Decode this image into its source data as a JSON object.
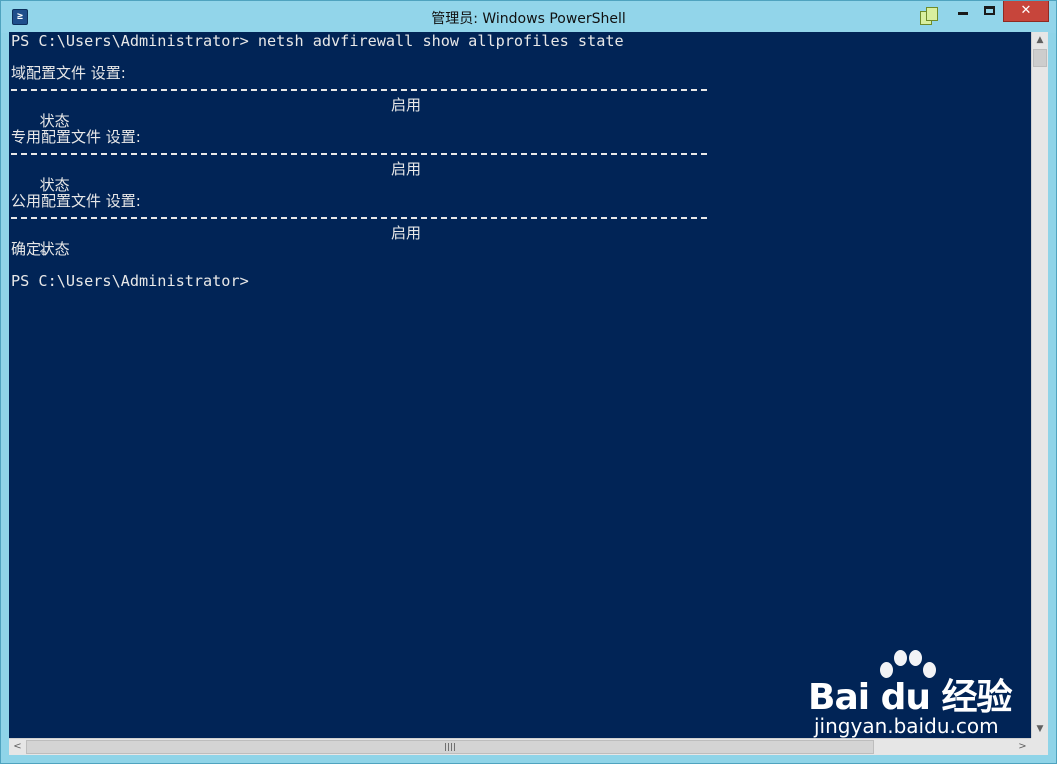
{
  "window": {
    "title": "管理员: Windows PowerShell",
    "close_glyph": "✕",
    "icon_glyph": "≥"
  },
  "console": {
    "lines": [
      {
        "text": "PS C:\\Users\\Administrator> netsh advfirewall show allprofiles state"
      },
      {
        "text": ""
      },
      {
        "text": "域配置文件 设置:"
      },
      {
        "text": "状态",
        "value": "启用"
      },
      {
        "text": ""
      },
      {
        "text": "专用配置文件 设置:"
      },
      {
        "text": "状态",
        "value": "启用"
      },
      {
        "text": ""
      },
      {
        "text": "公用配置文件 设置:"
      },
      {
        "text": "状态",
        "value": "启用"
      },
      {
        "text": "确定。"
      },
      {
        "text": ""
      },
      {
        "text": "PS C:\\Users\\Administrator>"
      }
    ]
  },
  "scrollbars": {
    "up_glyph": "▲",
    "down_glyph": "▼",
    "left_glyph": "<",
    "right_glyph": ">"
  },
  "watermark": {
    "brand": "Bai du 经验",
    "url": "jingyan.baidu.com"
  },
  "colors": {
    "console_bg": "#012456",
    "console_fg": "#e8e8e8",
    "titlebar_bg": "#92d5ea",
    "close_button": "#c7453b"
  }
}
